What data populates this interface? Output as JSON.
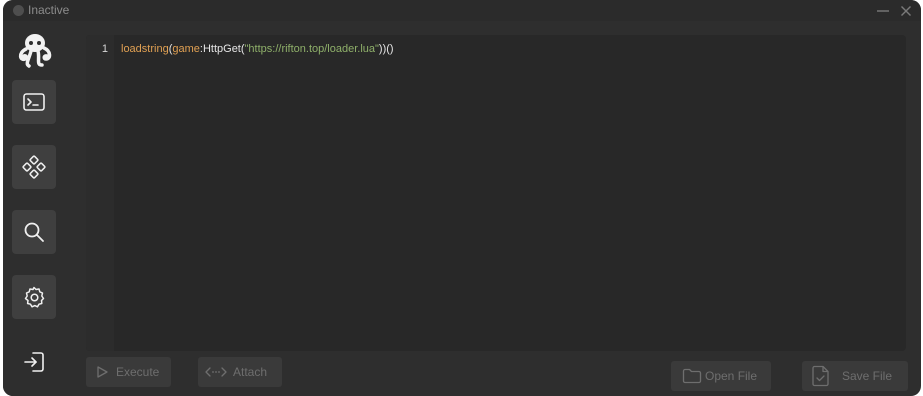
{
  "window": {
    "title": "Inactive",
    "colors": {
      "background": "#2e2e2e",
      "editor": "#282828",
      "button": "#3a3a3a",
      "accent_orange": "#e0a053",
      "accent_green": "#8fb06a"
    }
  },
  "titlebar": {
    "minimize_icon": "minimize-icon",
    "close_icon": "close-icon"
  },
  "sidebar": {
    "logo_icon": "octopus-logo-icon",
    "items": [
      {
        "id": "editor",
        "icon": "terminal-icon"
      },
      {
        "id": "scripts",
        "icon": "diamond-grid-icon"
      },
      {
        "id": "search",
        "icon": "search-icon"
      },
      {
        "id": "settings",
        "icon": "gear-icon"
      },
      {
        "id": "login",
        "icon": "login-icon"
      }
    ]
  },
  "editor": {
    "line_numbers": [
      "1"
    ],
    "tokens": [
      {
        "type": "fn",
        "text": "loadstring"
      },
      {
        "type": "plain",
        "text": "("
      },
      {
        "type": "obj",
        "text": "game"
      },
      {
        "type": "plain",
        "text": ":HttpGet("
      },
      {
        "type": "str",
        "text": "\"https://rifton.top/loader.lua\""
      },
      {
        "type": "plain",
        "text": "))()"
      }
    ]
  },
  "actions": {
    "execute_label": "Execute",
    "attach_label": "Attach",
    "open_file_label": "Open File",
    "save_file_label": "Save File"
  }
}
